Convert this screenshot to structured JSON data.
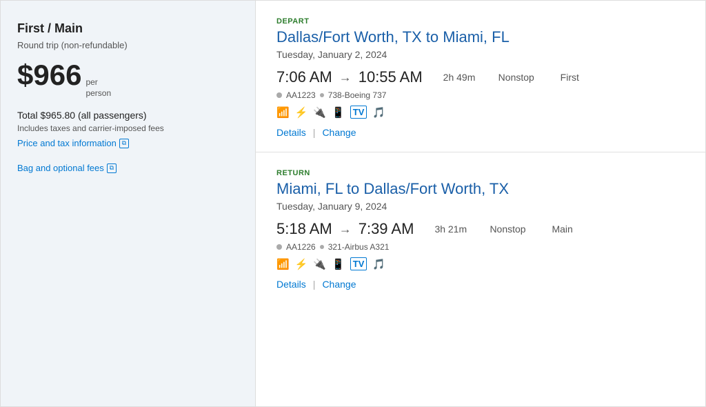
{
  "left": {
    "fare_title": "First / Main",
    "round_trip_label": "Round trip (non-refundable)",
    "price_main": "$966",
    "per_person_line1": "per",
    "per_person_line2": "person",
    "total_price": "Total $965.80 (all passengers)",
    "includes_taxes": "Includes taxes and carrier-imposed fees",
    "price_tax_link": "Price and tax information",
    "bag_fees_link": "Bag and optional fees"
  },
  "depart": {
    "tag": "DEPART",
    "route": "Dallas/Fort Worth, TX to Miami, FL",
    "date": "Tuesday, January 2, 2024",
    "depart_time": "7:06 AM",
    "arrive_time": "10:55 AM",
    "duration": "2h 49m",
    "nonstop": "Nonstop",
    "cabin": "First",
    "flight_number": "AA1223",
    "aircraft": "738-Boeing 737",
    "details_link": "Details",
    "change_link": "Change"
  },
  "return": {
    "tag": "RETURN",
    "route": "Miami, FL to Dallas/Fort Worth, TX",
    "date": "Tuesday, January 9, 2024",
    "depart_time": "5:18 AM",
    "arrive_time": "7:39 AM",
    "duration": "3h 21m",
    "nonstop": "Nonstop",
    "cabin": "Main",
    "flight_number": "AA1226",
    "aircraft": "321-Airbus A321",
    "details_link": "Details",
    "change_link": "Change"
  },
  "icons": {
    "wifi": "📶",
    "power": "🔌",
    "usb": "🔋",
    "phone": "📱",
    "tv": "📺",
    "music": "🎵",
    "external": "⊞"
  }
}
